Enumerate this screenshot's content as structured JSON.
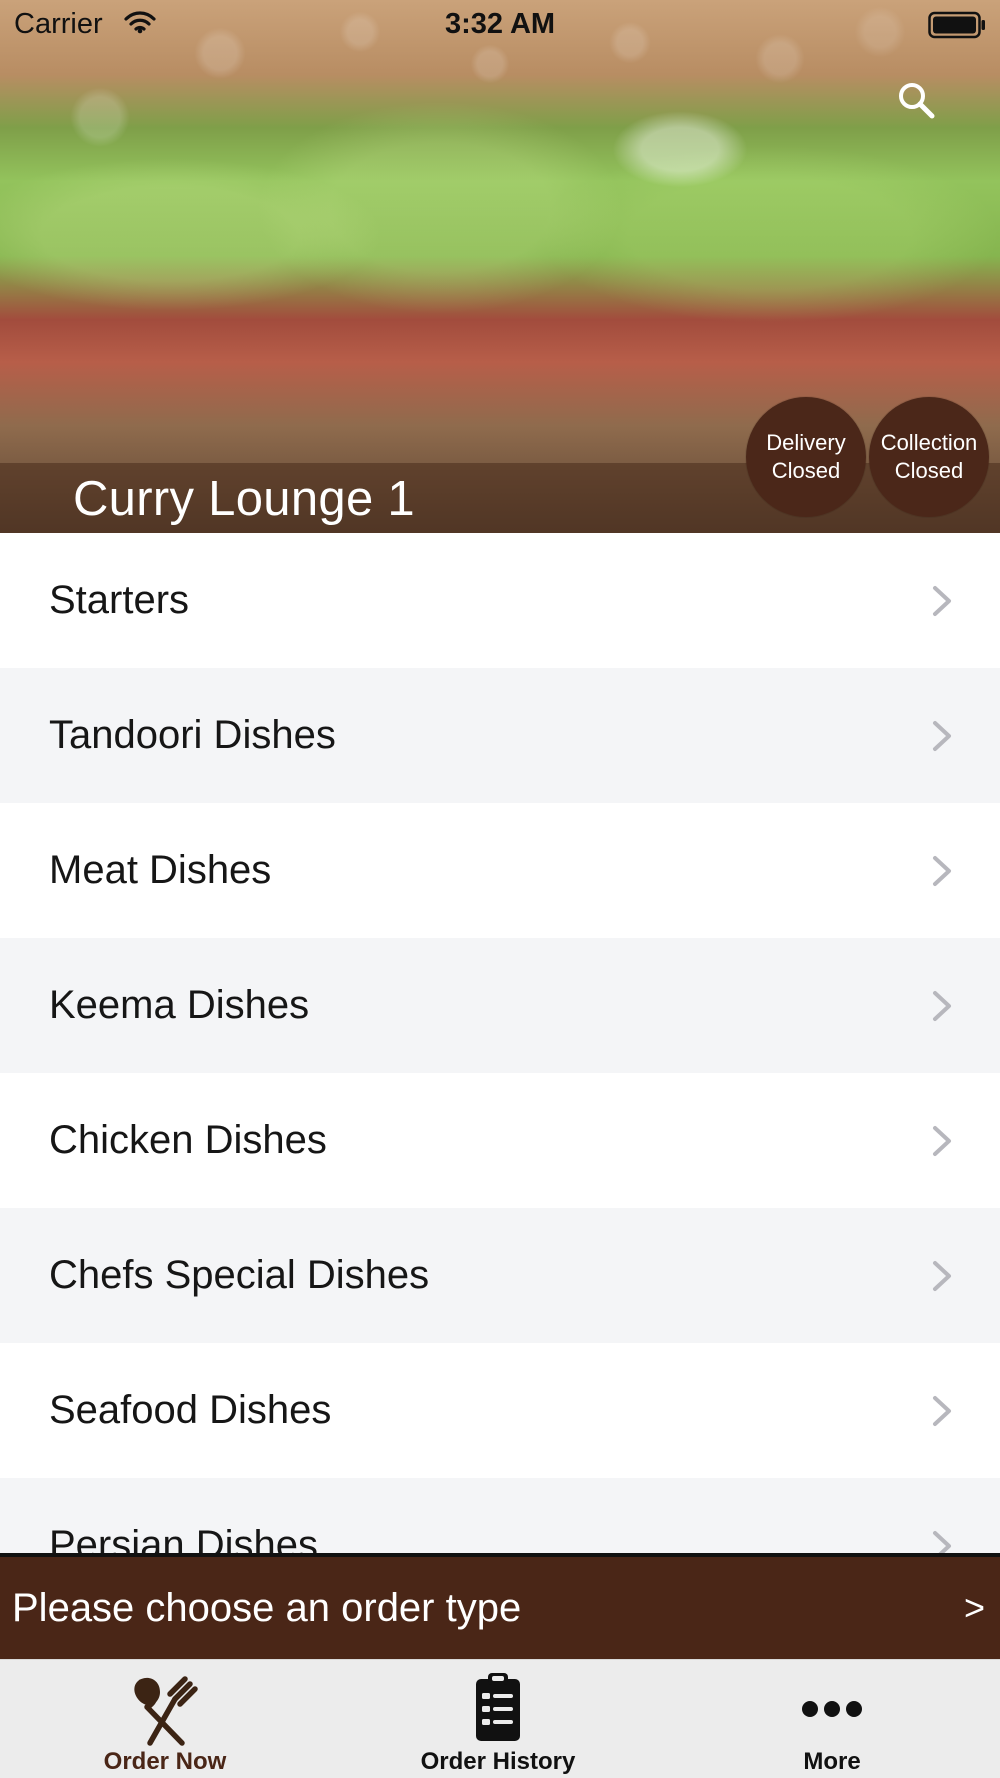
{
  "status_bar": {
    "carrier": "Carrier",
    "time": "3:32 AM",
    "wifi_icon": "wifi-icon",
    "battery_icon": "battery-icon"
  },
  "header": {
    "title": "Curry Lounge 1",
    "search_icon": "search-icon",
    "delivery_status": {
      "line1": "Delivery",
      "line2": "Closed"
    },
    "collection_status": {
      "line1": "Collection",
      "line2": "Closed"
    },
    "accent_color": "#4a2617"
  },
  "menu": {
    "items": [
      {
        "label": "Starters"
      },
      {
        "label": "Tandoori Dishes"
      },
      {
        "label": "Meat Dishes"
      },
      {
        "label": "Keema Dishes"
      },
      {
        "label": "Chicken Dishes"
      },
      {
        "label": "Chefs Special Dishes"
      },
      {
        "label": "Seafood Dishes"
      },
      {
        "label": "Persian Dishes"
      }
    ],
    "chevron_icon": "chevron-right-icon"
  },
  "order_prompt": {
    "text": "Please choose an order type",
    "arrow": ">"
  },
  "tab_bar": {
    "tabs": [
      {
        "label": "Order Now",
        "icon": "utensils-icon",
        "active": true
      },
      {
        "label": "Order History",
        "icon": "clipboard-list-icon",
        "active": false
      },
      {
        "label": "More",
        "icon": "more-icon",
        "active": false
      }
    ]
  }
}
